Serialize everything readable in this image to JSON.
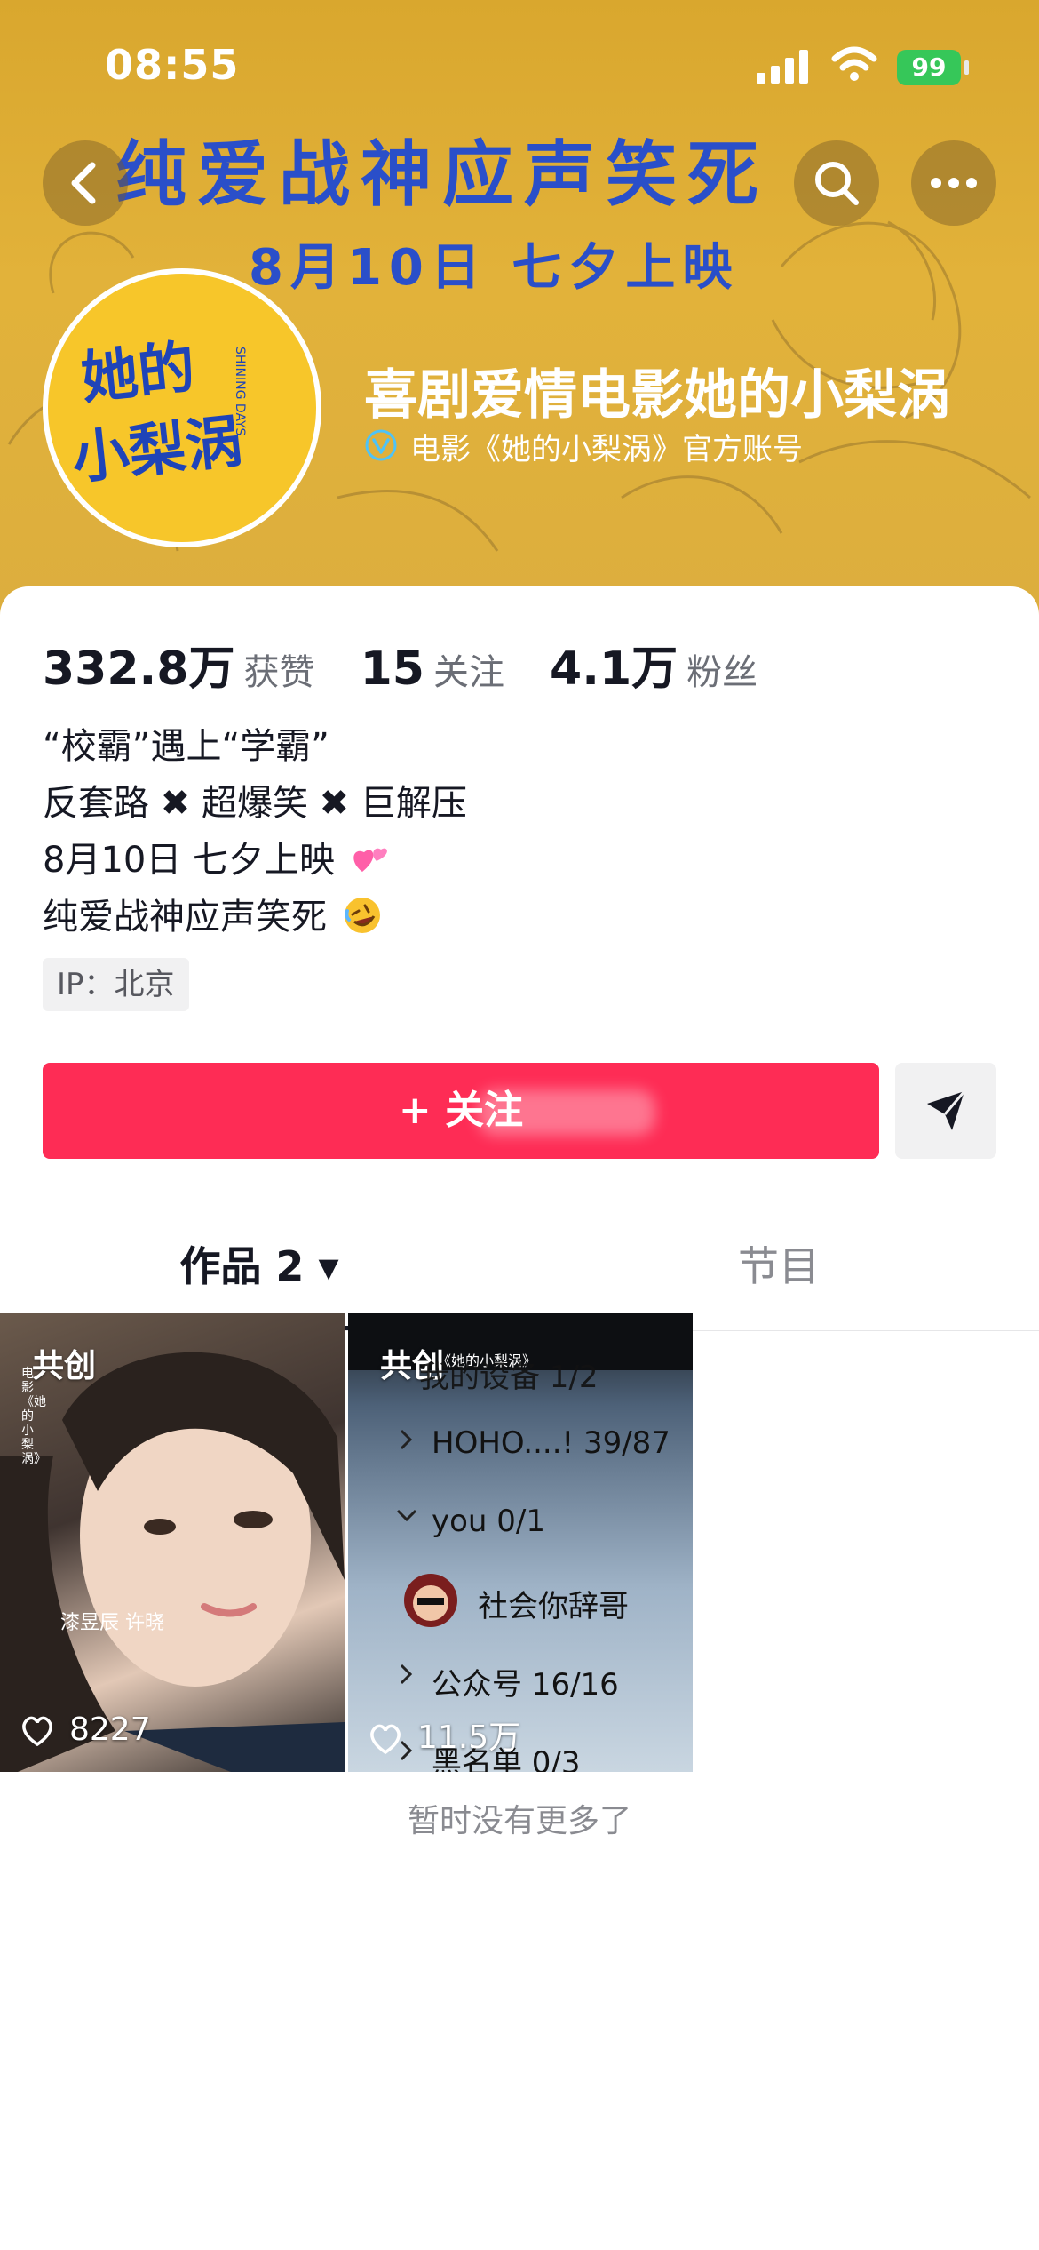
{
  "status_bar": {
    "time": "08:55",
    "battery": "99"
  },
  "banner": {
    "title": "纯爱战神应声笑死",
    "subtitle": "8月10日 七夕上映"
  },
  "profile": {
    "name": "喜剧爱情电影她的小梨涡",
    "verified_text": "电影《她的小梨涡》官方账号",
    "avatar_text": "她的小梨涡",
    "avatar_subtext": "SHINING DAYS"
  },
  "stats": [
    {
      "value": "332.8万",
      "label": "获赞"
    },
    {
      "value": "15",
      "label": "关注"
    },
    {
      "value": "4.1万",
      "label": "粉丝"
    }
  ],
  "bio": {
    "line1": "“校霸”遇上“学霸”",
    "line2": "反套路 ✖ 超爆笑 ✖ 巨解压",
    "line3": "8月10日 七夕上映",
    "line4": "纯爱战神应声笑死"
  },
  "ip_tag": "IP：北京",
  "follow_button": {
    "label": "+ 关注"
  },
  "tabs": {
    "works": "作品 2 ▾",
    "shows": "节目"
  },
  "videos": [
    {
      "badge": "共创",
      "likes": "8227",
      "caption_names": "漆昱辰  许晓",
      "side_text": "电影《她的小梨涡》"
    },
    {
      "badge": "共创",
      "likes": "11.5万",
      "top_text": "《她的小梨涡》",
      "list": [
        "我的设备 1/2",
        "HOHO....! 39/87",
        "you 0/1",
        "社会你辞哥",
        "公众号 16/16",
        "黑名单 0/3"
      ]
    }
  ],
  "footer_text": "暂时没有更多了",
  "colors": {
    "accent": "#fe2c55",
    "banner": "#dcae3e",
    "title_blue": "#2a4fc9",
    "avatar_yellow": "#f7c62a"
  }
}
